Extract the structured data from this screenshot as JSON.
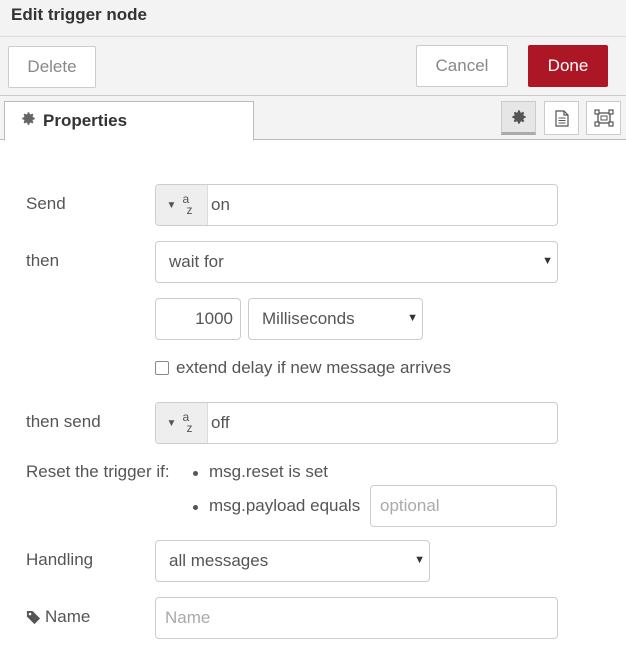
{
  "window": {
    "title": "Edit trigger node"
  },
  "toolbar": {
    "delete_label": "Delete",
    "cancel_label": "Cancel",
    "done_label": "Done"
  },
  "tabs": {
    "properties_label": "Properties",
    "icons": [
      "gear-icon",
      "description-icon",
      "appearance-icon"
    ]
  },
  "form": {
    "send_label": "Send",
    "send_value": "on",
    "send_type": "az",
    "then_label": "then",
    "then_select": "wait for",
    "delay_value": "1000",
    "delay_unit": "Milliseconds",
    "extend_label": "extend delay if new message arrives",
    "extend_checked": false,
    "then_send_label": "then send",
    "then_send_value": "off",
    "then_send_type": "az",
    "reset_label": "Reset the trigger if:",
    "reset_rule_1": "msg.reset is set",
    "reset_rule_2": "msg.payload equals",
    "reset_placeholder": "optional",
    "handling_label": "Handling",
    "handling_select": "all messages",
    "name_label": "Name",
    "name_placeholder": "Name"
  },
  "colors": {
    "done_bg": "#ad1625",
    "panel_bg": "#f3f3f3",
    "border": "#cccccc"
  }
}
